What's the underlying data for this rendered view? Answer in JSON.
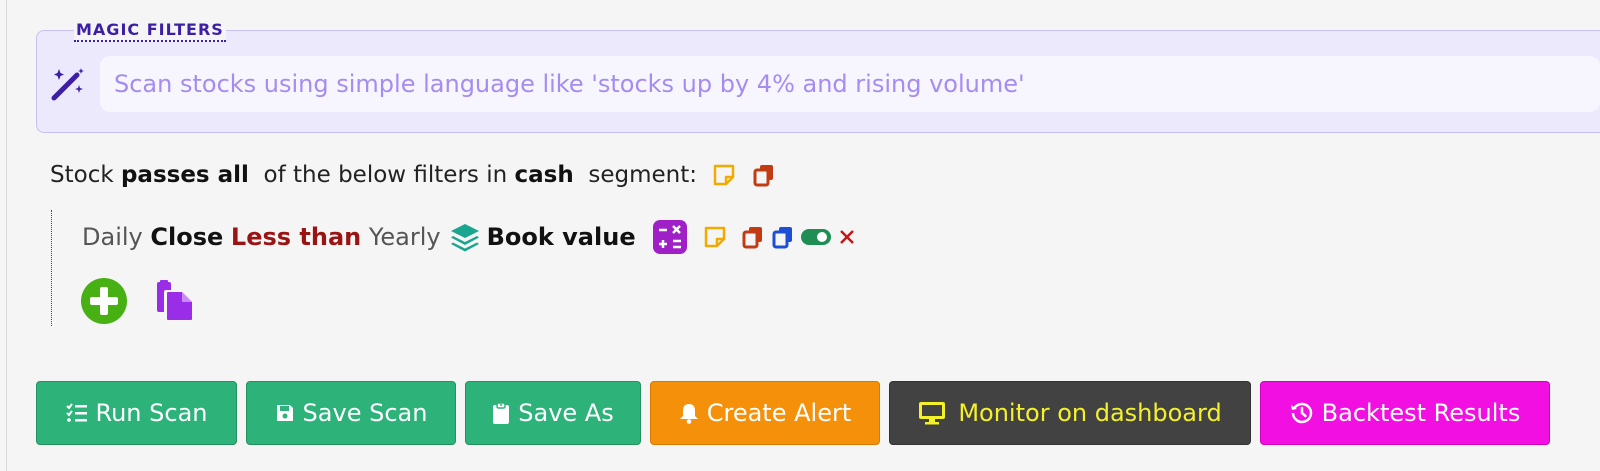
{
  "magic_filters": {
    "legend": "MAGIC FILTERS",
    "placeholder": "Scan stocks using simple language like 'stocks up by 4% and rising volume'",
    "value": "",
    "icon": "magic-wand-icon"
  },
  "summary": {
    "prefix": "Stock ",
    "mode": "passes all",
    "middle": "  of the below filters in ",
    "segment": "cash",
    "suffix": "  segment:",
    "icons": [
      "note-icon",
      "copy-icon"
    ]
  },
  "filter": {
    "period": "Daily",
    "field": "Close",
    "operator": "Less than",
    "period2": "Yearly",
    "metric_icon": "layers-icon",
    "metric": "Book value",
    "icons": [
      "calculator-icon",
      "note-icon",
      "copy-icon",
      "duplicate-icon",
      "toggle-icon",
      "close-icon"
    ]
  },
  "add_icons": [
    "add-circle-icon",
    "paste-icon"
  ],
  "buttons": {
    "run_scan": "Run Scan",
    "save_scan": "Save Scan",
    "save_as": "Save As",
    "create_alert": "Create Alert",
    "monitor": "Monitor on dashboard",
    "backtest": "Backtest Results"
  },
  "colors": {
    "green_button": "#2db37a",
    "alert_button": "#f5900a",
    "monitor_button": "#424242",
    "monitor_text": "#f4f02a",
    "backtest_button": "#f20fe2",
    "operator_text": "#9b1414",
    "magic_accent": "#3d1fa6"
  }
}
